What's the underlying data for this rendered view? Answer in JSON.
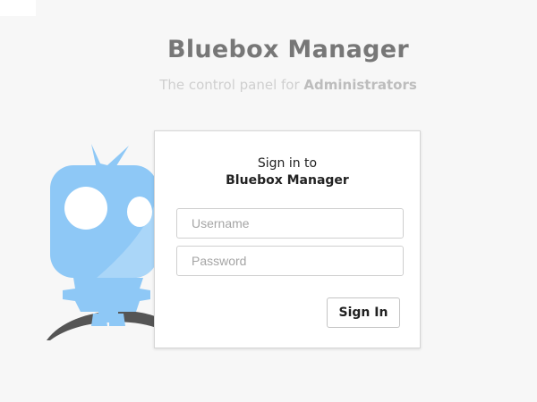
{
  "header": {
    "title": "Bluebox Manager",
    "subtitle_prefix": "The control panel for ",
    "subtitle_emphasis": "Administrators"
  },
  "login": {
    "heading_line1": "Sign in to",
    "heading_line2": "Bluebox Manager",
    "username_placeholder": "Username",
    "password_placeholder": "Password",
    "submit_label": "Sign In"
  },
  "icons": {
    "mascot": "robot-mascot-icon"
  },
  "colors": {
    "background": "#f7f7f7",
    "mascot_blue": "#8ec8f6",
    "mascot_light": "#b6dcfa",
    "mascot_shadow": "#555555",
    "title_gray": "#777777",
    "subtitle_gray": "#cfcfcf"
  }
}
